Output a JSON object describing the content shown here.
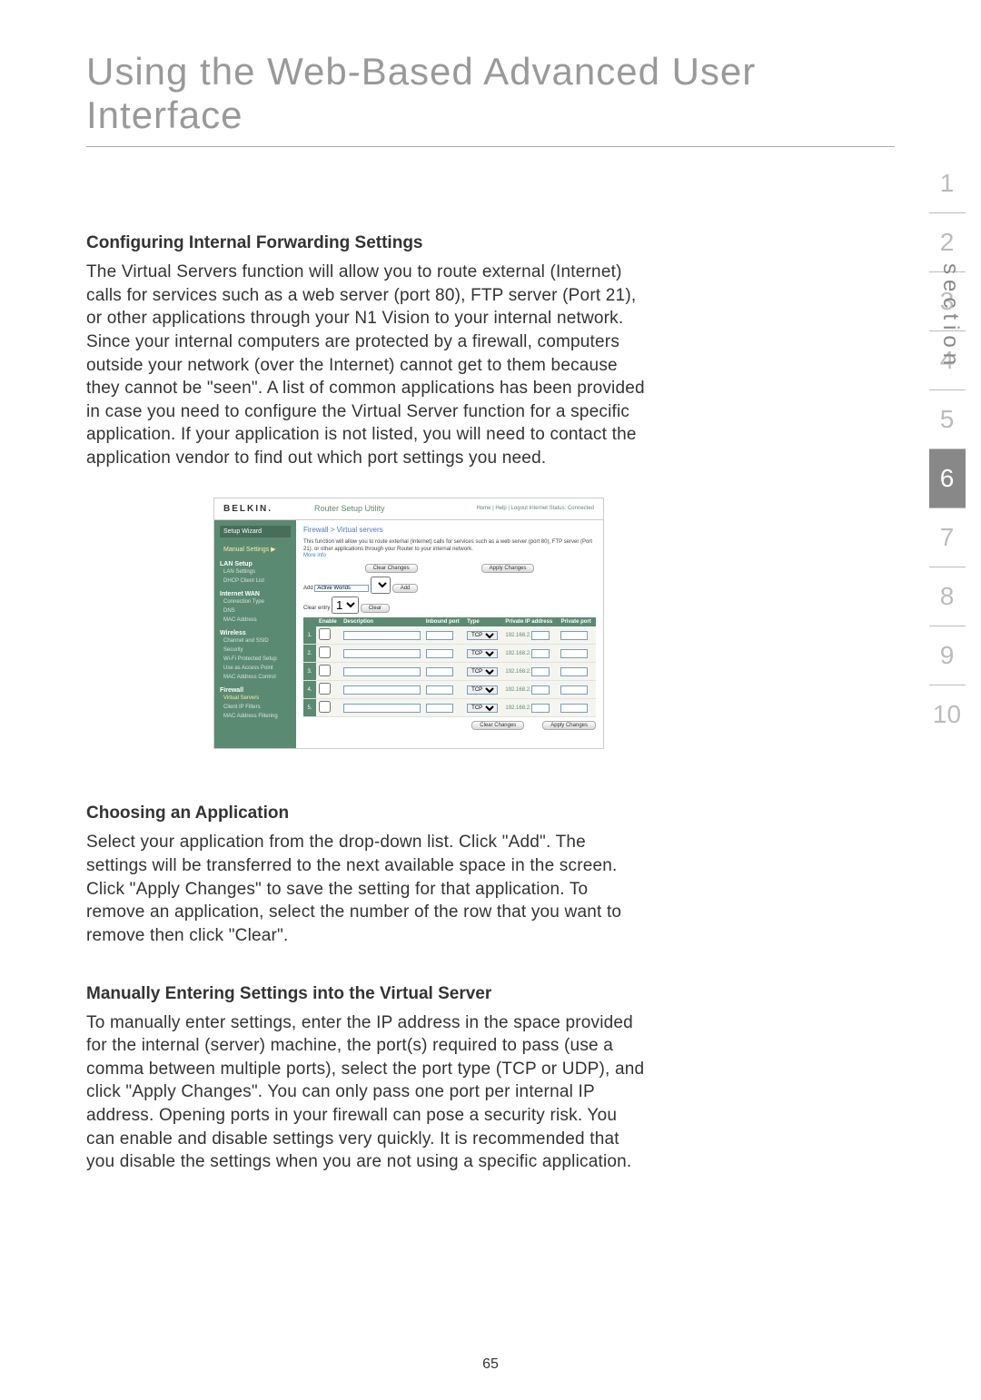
{
  "page_title": "Using the Web-Based Advanced User Interface",
  "page_number": "65",
  "section_label": "section",
  "section_numbers": [
    "1",
    "2",
    "3",
    "4",
    "5",
    "6",
    "7",
    "8",
    "9",
    "10"
  ],
  "active_section": "6",
  "sec1": {
    "heading": "Configuring Internal Forwarding Settings",
    "body": "The Virtual Servers function will allow you to route external (Internet) calls for services such as a web server (port 80), FTP server (Port 21), or other applications through your N1 Vision to your internal network. Since your internal computers are protected by a firewall, computers outside your network (over the Internet) cannot get to them because they cannot be \"seen\". A list of common applications has been provided in case you need to configure the Virtual Server function for a specific application. If your application is not listed, you will need to contact the application vendor to find out which port settings you need."
  },
  "sec2": {
    "heading": "Choosing an Application",
    "body": "Select your application from the drop-down list. Click \"Add\". The settings will be transferred to the next available space in the screen. Click \"Apply Changes\" to save the setting for that application. To remove an application, select the number of the row that you want to remove then click \"Clear\"."
  },
  "sec3": {
    "heading": "Manually Entering Settings into the Virtual Server",
    "body": "To manually enter settings, enter the IP address in the space provided for the internal (server) machine, the port(s) required to pass (use a comma between multiple ports), select the port type (TCP or UDP), and click \"Apply Changes\". You can only pass one port per internal IP address. Opening ports in your firewall can pose a security risk. You can enable and disable settings very quickly. It is recommended that you disable the settings when you are not using a specific application."
  },
  "router": {
    "brand": "BELKIN.",
    "title": "Router Setup Utility",
    "links": "Home | Help | Logout   Internet Status: Connected",
    "wizard": "Setup Wizard",
    "manual": "Manual Settings ▶",
    "side_groups": [
      {
        "title": "LAN Setup",
        "items": [
          "LAN Settings",
          "DHCP Client List"
        ]
      },
      {
        "title": "Internet WAN",
        "items": [
          "Connection Type",
          "DNS",
          "MAC Address"
        ]
      },
      {
        "title": "Wireless",
        "items": [
          "Channel and SSID",
          "Security",
          "Wi-Fi Protected Setup",
          "Use as Access Point",
          "MAC Address Control"
        ]
      },
      {
        "title": "Firewall",
        "items": [
          "Virtual Servers",
          "Client IP Filters",
          "MAC Address Filtering"
        ]
      }
    ],
    "crumb": "Firewall > Virtual servers",
    "desc": "This function will allow you to route external (Internet) calls for services such as a web server (port 80), FTP server (Port 21), or other applications through your Router to your internal network.",
    "more": "More info",
    "btn_clear_changes": "Clear Changes",
    "btn_apply_changes": "Apply Changes",
    "add_label": "Add",
    "add_value": "Active Worlds",
    "add_btn": "Add",
    "clear_label": "Clear entry",
    "clear_value": "1",
    "clear_btn": "Clear",
    "table_headers": [
      "",
      "Enable",
      "Description",
      "Inbound port",
      "Type",
      "Private IP address",
      "Private port"
    ],
    "rows": [
      {
        "n": "1.",
        "ip": "192.168.2.",
        "type": "TCP"
      },
      {
        "n": "2.",
        "ip": "192.168.2.",
        "type": "TCP"
      },
      {
        "n": "3.",
        "ip": "192.168.2.",
        "type": "TCP"
      },
      {
        "n": "4.",
        "ip": "192.168.2.",
        "type": "TCP"
      },
      {
        "n": "5.",
        "ip": "192.168.2.",
        "type": "TCP"
      }
    ]
  }
}
